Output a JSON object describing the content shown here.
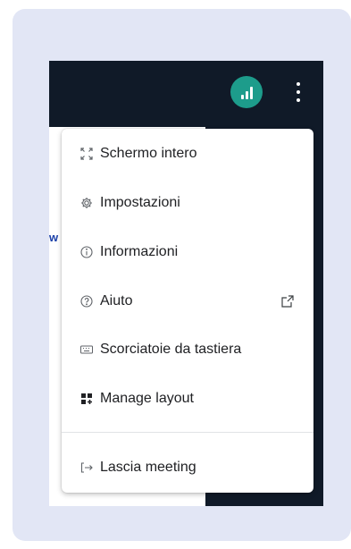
{
  "toolbar": {
    "signal_icon": "signal-bars-icon",
    "more_icon": "more-vert-icon",
    "accent_color": "#1d9c8b"
  },
  "background_partial_text": "w",
  "menu": {
    "items": [
      {
        "label": "Schermo intero",
        "icon": "fullscreen-icon"
      },
      {
        "label": "Impostazioni",
        "icon": "gear-icon"
      },
      {
        "label": "Informazioni",
        "icon": "info-icon"
      },
      {
        "label": "Aiuto",
        "icon": "help-icon",
        "trailing_icon": "external-link-icon"
      },
      {
        "label": "Scorciatoie da tastiera",
        "icon": "keyboard-icon"
      },
      {
        "label": "Manage layout",
        "icon": "layout-icon"
      },
      {
        "label": "Lascia meeting",
        "icon": "leave-icon"
      }
    ]
  }
}
